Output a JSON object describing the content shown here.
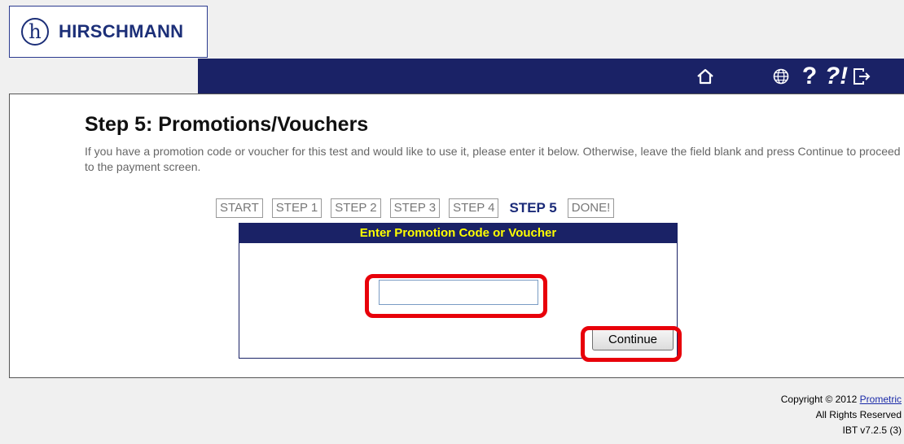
{
  "brand": {
    "logo_glyph": "h",
    "name": "HIRSCHMANN",
    "color": "#1c2f78"
  },
  "nav": {
    "bar_color": "#1a2266",
    "icons": [
      "home-icon",
      "globe-icon",
      "help-icon",
      "faq-icon",
      "logout-icon"
    ],
    "help_label": "?",
    "faq_label": "?!"
  },
  "page": {
    "title": "Step 5: Promotions/Vouchers",
    "instructions": "If you have a promotion code or voucher for this test and would like to use it, please enter it below. Otherwise, leave the field blank and press Continue to proceed to the payment screen."
  },
  "steps": [
    {
      "label": "START",
      "current": false
    },
    {
      "label": "STEP 1",
      "current": false
    },
    {
      "label": "STEP 2",
      "current": false
    },
    {
      "label": "STEP 3",
      "current": false
    },
    {
      "label": "STEP 4",
      "current": false
    },
    {
      "label": "STEP 5",
      "current": true
    },
    {
      "label": "DONE!",
      "current": false
    }
  ],
  "voucher_form": {
    "header": "Enter Promotion Code or Voucher",
    "header_color": "#ffff00",
    "input_value": "",
    "input_placeholder": "",
    "continue_label": "Continue"
  },
  "highlight_color": "#e8000a",
  "footer": {
    "copyright_prefix": "Copyright © 2012 ",
    "copyright_link": "Prometric",
    "rights": "All Rights Reserved",
    "version": "IBT v7.2.5 (3)"
  }
}
